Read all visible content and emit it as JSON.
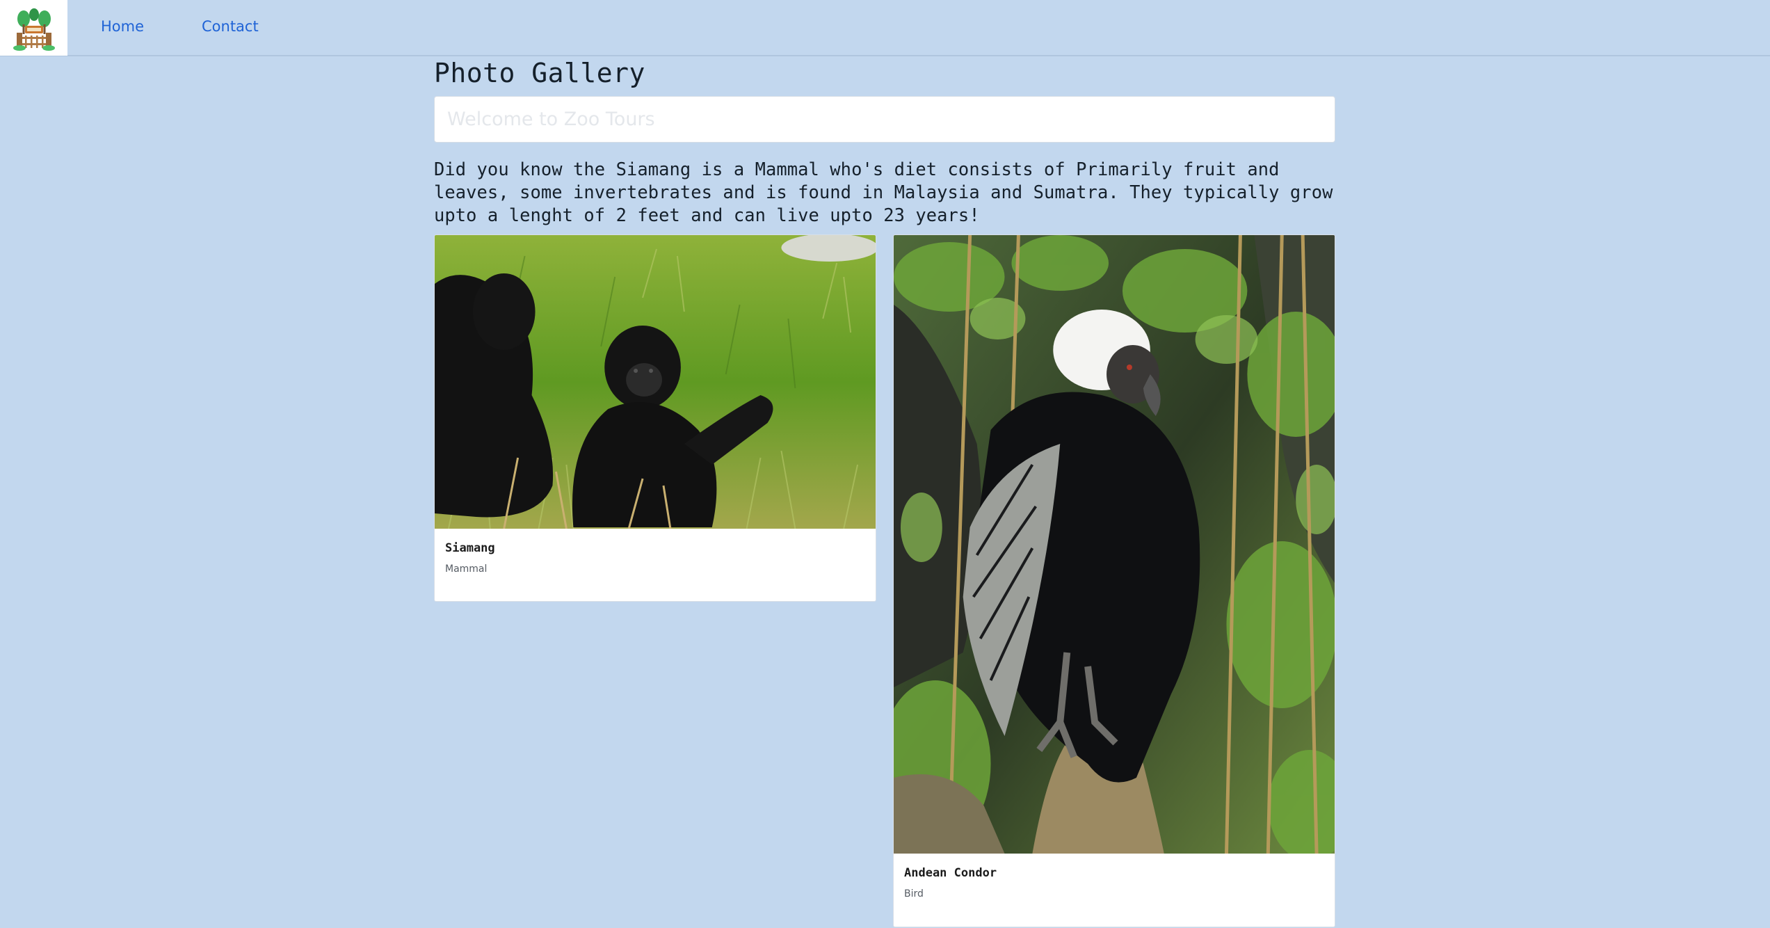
{
  "nav": {
    "logo_icon": "zoo-logo-icon",
    "links": [
      {
        "label": "Home"
      },
      {
        "label": "Contact"
      }
    ]
  },
  "page": {
    "title": "Photo Gallery",
    "search_placeholder": "Welcome to Zoo Tours",
    "fact": "Did you know the Siamang is a Mammal who's diet consists of Primarily fruit and leaves, some invertebrates and is found in Malaysia and Sumatra. They typically grow upto a lenght of 2 feet and can live upto 23 years!"
  },
  "gallery": [
    {
      "name": "Siamang",
      "type": "Mammal",
      "image_icon": "siamang-photo"
    },
    {
      "name": "Andean Condor",
      "type": "Bird",
      "image_icon": "andean-condor-photo"
    }
  ],
  "colors": {
    "background": "#c2d7ee",
    "link": "#1f63d6",
    "card": "#ffffff",
    "text": "#15202b"
  }
}
